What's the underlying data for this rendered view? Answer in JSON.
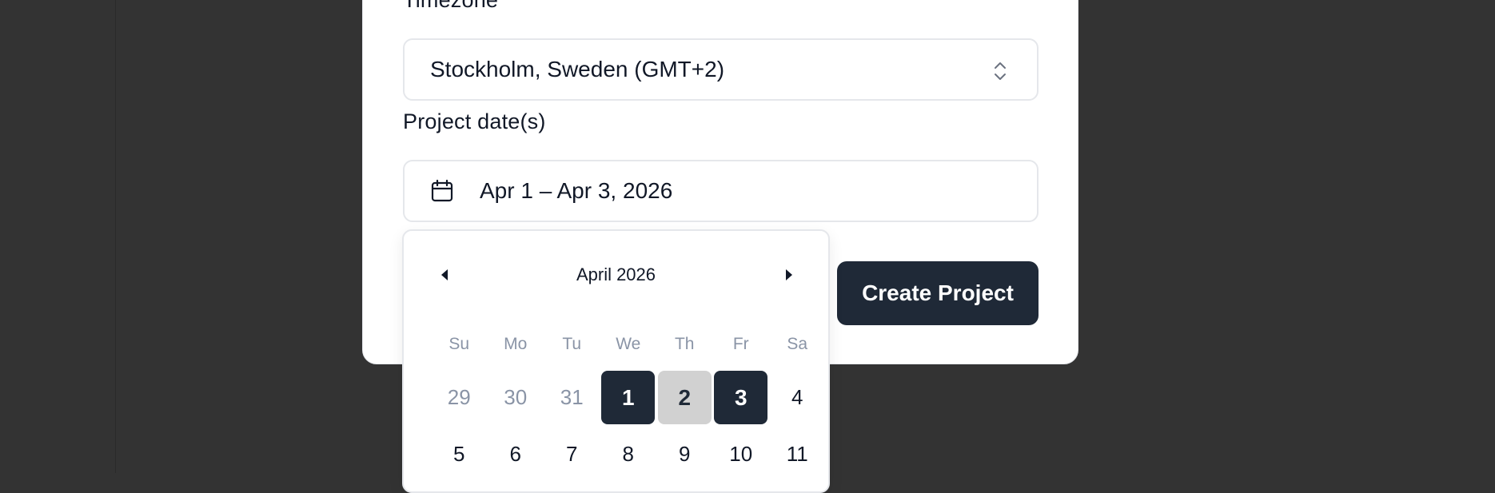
{
  "form": {
    "timezone_label": "Timezone",
    "timezone_value": "Stockholm, Sweden (GMT+2)",
    "dates_label": "Project date(s)",
    "dates_value": "Apr 1 – Apr 3, 2026",
    "create_button": "Create Project"
  },
  "calendar": {
    "month_title": "April 2026",
    "weekdays": [
      "Su",
      "Mo",
      "Tu",
      "We",
      "Th",
      "Fr",
      "Sa"
    ],
    "days": [
      {
        "label": "29",
        "state": "outside"
      },
      {
        "label": "30",
        "state": "outside"
      },
      {
        "label": "31",
        "state": "outside"
      },
      {
        "label": "1",
        "state": "range-end"
      },
      {
        "label": "2",
        "state": "range-mid"
      },
      {
        "label": "3",
        "state": "range-end"
      },
      {
        "label": "4",
        "state": "normal"
      },
      {
        "label": "5",
        "state": "normal"
      },
      {
        "label": "6",
        "state": "normal"
      },
      {
        "label": "7",
        "state": "normal"
      },
      {
        "label": "8",
        "state": "normal"
      },
      {
        "label": "9",
        "state": "normal"
      },
      {
        "label": "10",
        "state": "normal"
      },
      {
        "label": "11",
        "state": "normal"
      }
    ]
  },
  "icons": {
    "timezone_select": "chevron-up-down-icon",
    "date_field": "calendar-icon",
    "prev_month": "triangle-left-icon",
    "next_month": "triangle-right-icon"
  },
  "colors": {
    "background": "#333333",
    "card": "#ffffff",
    "accent": "#1f2937",
    "range_mid": "#d1d1d1",
    "muted_text": "#8a94a6"
  }
}
